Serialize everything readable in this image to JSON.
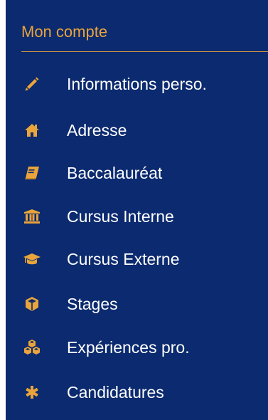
{
  "sidebar": {
    "title": "Mon compte",
    "accent_color": "#e9a43b",
    "background_color": "#0b2a6f",
    "items": [
      {
        "label": "Informations perso.",
        "icon": "pencil-icon"
      },
      {
        "label": "Adresse",
        "icon": "home-icon"
      },
      {
        "label": "Baccalauréat",
        "icon": "book-icon"
      },
      {
        "label": "Cursus Interne",
        "icon": "institution-icon"
      },
      {
        "label": "Cursus Externe",
        "icon": "graduation-cap-icon"
      },
      {
        "label": "Stages",
        "icon": "cube-icon"
      },
      {
        "label": "Expériences pro.",
        "icon": "cubes-icon"
      },
      {
        "label": "Candidatures",
        "icon": "asterisk-icon"
      }
    ]
  }
}
